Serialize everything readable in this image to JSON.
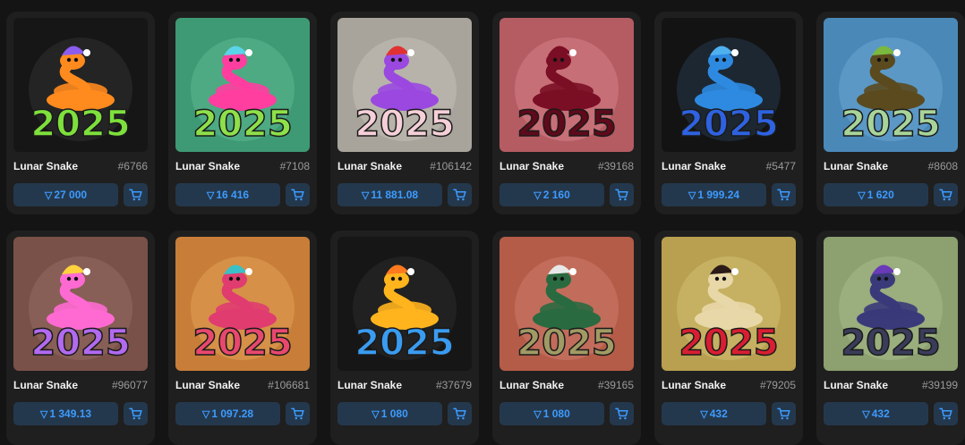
{
  "currency_symbol": "▽",
  "cards": [
    {
      "name": "Lunar Snake",
      "number": "#6766",
      "price": "27 000",
      "bg": "#161616",
      "glow": "#2b2b2b",
      "snake": "#ff8a1e",
      "hat": "#8a5cf0",
      "digits": "#7ee03c"
    },
    {
      "name": "Lunar Snake",
      "number": "#7108",
      "price": "16 416",
      "bg": "#3e9a74",
      "glow": "#56b08a",
      "snake": "#ff3ea0",
      "hat": "#5ad4e8",
      "digits": "#8ee04a"
    },
    {
      "name": "Lunar Snake",
      "number": "#106142",
      "price": "11 881.08",
      "bg": "#a8a49c",
      "glow": "#bdb9b1",
      "snake": "#9a48e0",
      "hat": "#e03232",
      "digits": "#f5d0d8"
    },
    {
      "name": "Lunar Snake",
      "number": "#39168",
      "price": "2 160",
      "bg": "#b45c62",
      "glow": "#cf7780",
      "snake": "#7a0e24",
      "hat": "#7a0e24",
      "digits": "#5e0a1a"
    },
    {
      "name": "Lunar Snake",
      "number": "#5477",
      "price": "1 999.24",
      "bg": "#131313",
      "glow": "#223040",
      "snake": "#2e8ae0",
      "hat": "#4fb0f0",
      "digits": "#2e62e0"
    },
    {
      "name": "Lunar Snake",
      "number": "#8608",
      "price": "1 620",
      "bg": "#4a88b8",
      "glow": "#62a0cc",
      "snake": "#5a4a1e",
      "hat": "#7ab840",
      "digits": "#a8d49a"
    },
    {
      "name": "Lunar Snake",
      "number": "#96077",
      "price": "1 349.13",
      "bg": "#7a5148",
      "glow": "#8e655c",
      "snake": "#ff6ad2",
      "hat": "#ffd23e",
      "digits": "#b26af0"
    },
    {
      "name": "Lunar Snake",
      "number": "#106681",
      "price": "1 097.28",
      "bg": "#c87e38",
      "glow": "#dc9850",
      "snake": "#e03c70",
      "hat": "#3cc0c8",
      "digits": "#e8486e"
    },
    {
      "name": "Lunar Snake",
      "number": "#37679",
      "price": "1 080",
      "bg": "#161616",
      "glow": "#262626",
      "snake": "#ffb41e",
      "hat": "#ff7a1e",
      "digits": "#3a9cf0"
    },
    {
      "name": "Lunar Snake",
      "number": "#39165",
      "price": "1 080",
      "bg": "#b45c48",
      "glow": "#c87464",
      "snake": "#2a6a40",
      "hat": "#e8e8e8",
      "digits": "#a09a64"
    },
    {
      "name": "Lunar Snake",
      "number": "#79205",
      "price": "432",
      "bg": "#b8a050",
      "glow": "#ccb86a",
      "snake": "#e8d8a8",
      "hat": "#2a1a18",
      "digits": "#d81e32"
    },
    {
      "name": "Lunar Snake",
      "number": "#39199",
      "price": "432",
      "bg": "#8ca070",
      "glow": "#a0b484",
      "snake": "#3a3a7a",
      "hat": "#6a3ab8",
      "digits": "#3a3c5a"
    }
  ]
}
